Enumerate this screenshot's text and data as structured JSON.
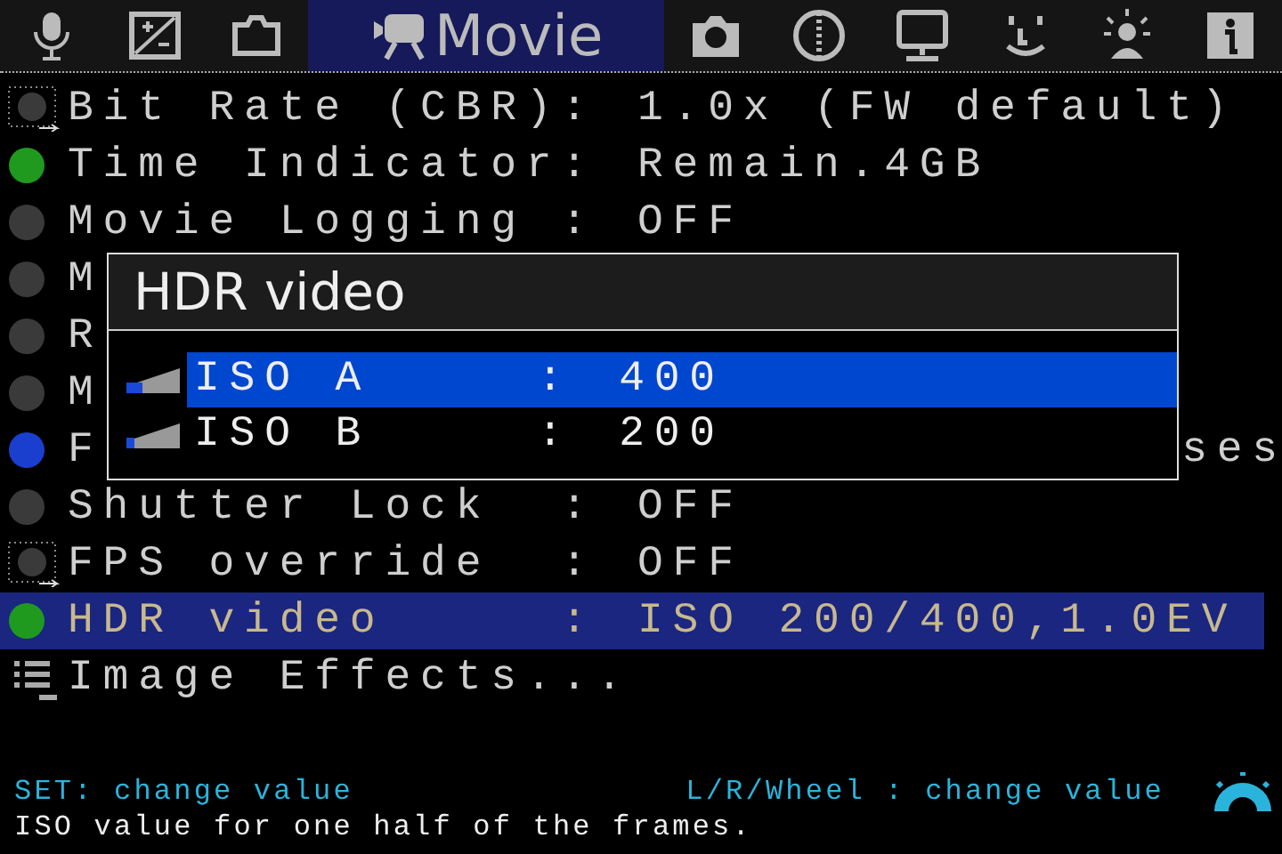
{
  "tabs": [
    {
      "selected": false
    },
    {
      "selected": false
    },
    {
      "selected": false
    },
    {
      "label": "Movie",
      "selected": true
    },
    {
      "selected": false
    },
    {
      "selected": false
    },
    {
      "selected": false
    },
    {
      "selected": false
    },
    {
      "selected": false
    },
    {
      "selected": false
    }
  ],
  "menu": [
    {
      "kind": "submenu",
      "label": "Bit Rate (CBR):",
      "value": "1.0x (FW default)",
      "selected": false
    },
    {
      "kind": "dot",
      "color": "#1f9a1f",
      "label": "Time Indicator:",
      "value": "Remain.4GB",
      "selected": false
    },
    {
      "kind": "dot",
      "color": "#3a3a3a",
      "label": "Movie Logging :",
      "value": "OFF",
      "selected": false
    },
    {
      "kind": "dot",
      "color": "#3a3a3a",
      "label": "M",
      "selected": false
    },
    {
      "kind": "dot",
      "color": "#3a3a3a",
      "label": "R",
      "selected": false
    },
    {
      "kind": "dot",
      "color": "#3a3a3a",
      "label": "M",
      "selected": false
    },
    {
      "kind": "dot",
      "color": "#1a3fcf",
      "label": "F",
      "tail": "ses",
      "selected": false
    },
    {
      "kind": "dot",
      "color": "#3a3a3a",
      "label": "Shutter Lock  :",
      "value": "OFF",
      "selected": false
    },
    {
      "kind": "submenu",
      "label": "FPS override  :",
      "value": "OFF",
      "selected": false
    },
    {
      "kind": "dot",
      "color": "#1f9a1f",
      "label": "HDR video     :",
      "value": "ISO 200/400,1.0EV",
      "selected": true
    },
    {
      "kind": "list",
      "label": "Image Effects...",
      "selected": false
    }
  ],
  "dialog": {
    "title": "HDR video",
    "items": [
      {
        "label": "ISO A",
        "separator": ":",
        "value": "400",
        "level": 0.3,
        "selected": true
      },
      {
        "label": "ISO B",
        "separator": ":",
        "value": "200",
        "level": 0.15,
        "selected": false
      }
    ]
  },
  "hints": {
    "left": "SET: change value",
    "right": "L/R/Wheel : change value",
    "help": "ISO value for one half of the frames."
  }
}
